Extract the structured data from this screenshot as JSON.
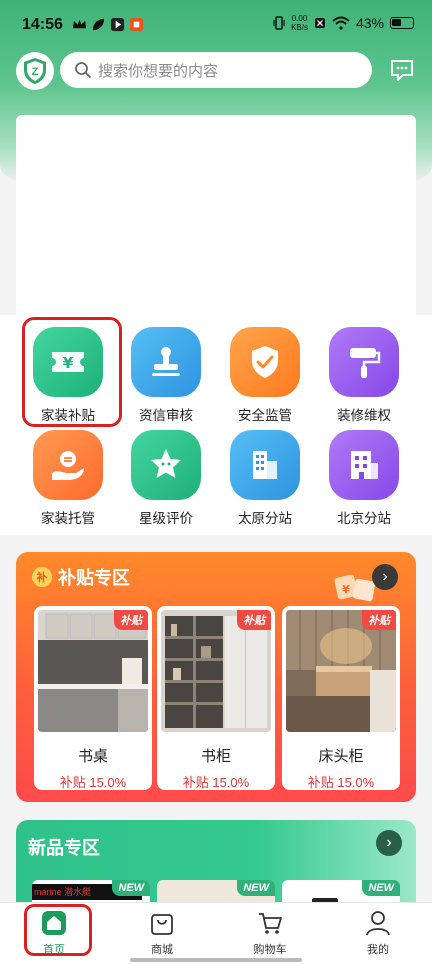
{
  "status_bar": {
    "time": "14:56",
    "net_speed_value": "0.00",
    "net_speed_unit": "KB/s",
    "battery": "43%"
  },
  "search": {
    "placeholder": "搜索你想要的内容"
  },
  "colors": {
    "brand_green": "#3fb277",
    "subsidy_orange": "#ff6a35",
    "highlight_red": "#d92121",
    "nav_active": "#1e9b5c"
  },
  "services": [
    {
      "label": "家装补贴",
      "icon": "yuan-ticket-icon",
      "color": "#2ec490"
    },
    {
      "label": "资信审核",
      "icon": "stamp-icon",
      "color": "#3aa7ec"
    },
    {
      "label": "安全监管",
      "icon": "shield-check-icon",
      "color": "#ff8a2a"
    },
    {
      "label": "装修维权",
      "icon": "paint-roller-icon",
      "color": "#9a5cf0"
    },
    {
      "label": "家装托管",
      "icon": "hand-coin-icon",
      "color": "#ff7a35"
    },
    {
      "label": "星级评价",
      "icon": "star-face-icon",
      "color": "#2ec490"
    },
    {
      "label": "太原分站",
      "icon": "building-icon",
      "color": "#3aa7ec"
    },
    {
      "label": "北京分站",
      "icon": "office-icon",
      "color": "#9a5cf0"
    }
  ],
  "subsidy_zone": {
    "title": "补贴专区",
    "coin_char": "补",
    "items": [
      {
        "name": "书桌",
        "rate": "补贴 15.0%",
        "tag": "补贴"
      },
      {
        "name": "书柜",
        "rate": "补贴 15.0%",
        "tag": "补贴"
      },
      {
        "name": "床头柜",
        "rate": "补贴 15.0%",
        "tag": "补贴"
      }
    ]
  },
  "new_zone": {
    "title": "新品专区",
    "tags": [
      "NEW",
      "NEW",
      "NEW"
    ],
    "card1_brand": "marine 潜水艇"
  },
  "bottom_nav": [
    {
      "label": "首页",
      "icon": "home-icon",
      "active": true
    },
    {
      "label": "商城",
      "icon": "shopping-bag-icon",
      "active": false
    },
    {
      "label": "购物车",
      "icon": "cart-icon",
      "active": false
    },
    {
      "label": "我的",
      "icon": "person-icon",
      "active": false
    }
  ]
}
